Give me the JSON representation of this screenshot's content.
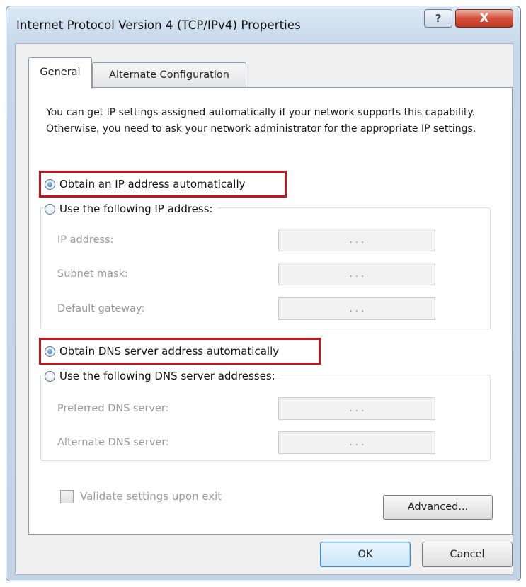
{
  "window": {
    "title": "Internet Protocol Version 4 (TCP/IPv4) Properties",
    "help_label": "?",
    "close_label": "X"
  },
  "tabs": [
    {
      "label": "General",
      "selected": true
    },
    {
      "label": "Alternate Configuration",
      "selected": false
    }
  ],
  "description": "You can get IP settings assigned automatically if your network supports this capability. Otherwise, you need to ask your network administrator for the appropriate IP settings.",
  "ip": {
    "auto_label": "Obtain an IP address automatically",
    "manual_label": "Use the following IP address:",
    "selected": "auto",
    "fields": [
      {
        "label": "IP address:",
        "value": ". . ."
      },
      {
        "label": "Subnet mask:",
        "value": ". . ."
      },
      {
        "label": "Default gateway:",
        "value": ". . ."
      }
    ]
  },
  "dns": {
    "auto_label": "Obtain DNS server address automatically",
    "manual_label": "Use the following DNS server addresses:",
    "selected": "auto",
    "fields": [
      {
        "label": "Preferred DNS server:",
        "value": ". . ."
      },
      {
        "label": "Alternate DNS server:",
        "value": ". . ."
      }
    ]
  },
  "validate": {
    "label": "Validate settings upon exit",
    "checked": false
  },
  "buttons": {
    "advanced": "Advanced...",
    "ok": "OK",
    "cancel": "Cancel"
  },
  "colors": {
    "highlight": "#c4161c",
    "close_button": "#c0361f",
    "title_bar": "#c6d7ea"
  }
}
